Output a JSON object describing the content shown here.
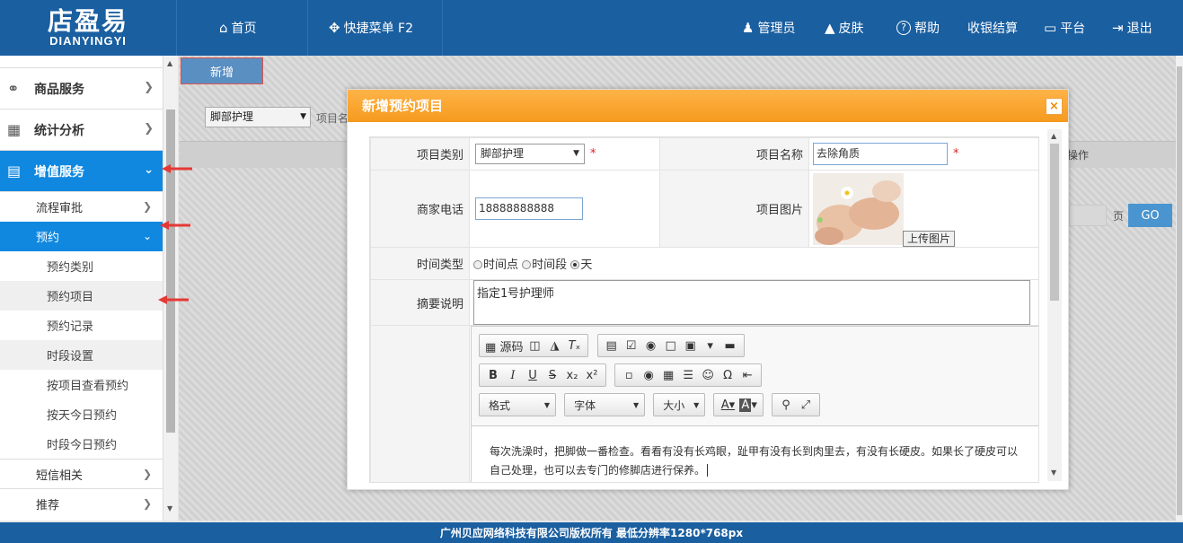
{
  "header": {
    "logo_main": "店盈易",
    "logo_sub": "DIANYINGYI",
    "nav_left": [
      {
        "icon": "home-icon",
        "glyph": "⌂",
        "label": "首页"
      },
      {
        "icon": "move-icon",
        "glyph": "✥",
        "label": "快捷菜单 F2"
      }
    ],
    "nav_right": [
      {
        "icon": "user-icon",
        "glyph": "👤",
        "label": "管理员"
      },
      {
        "icon": "shirt-icon",
        "glyph": "👕",
        "label": "皮肤"
      },
      {
        "icon": "help-icon",
        "glyph": "?",
        "label": "帮助"
      },
      {
        "icon": "",
        "glyph": "",
        "label": "收银结算"
      },
      {
        "icon": "monitor-icon",
        "glyph": "▭",
        "label": "平台"
      },
      {
        "icon": "logout-icon",
        "glyph": "⇥",
        "label": "退出"
      }
    ]
  },
  "sidebar": {
    "mains": [
      {
        "label": "商品服务",
        "icon": "link-icon",
        "glyph": "🔗"
      },
      {
        "label": "统计分析",
        "icon": "chart-icon",
        "glyph": "📊"
      },
      {
        "label": "增值服务",
        "icon": "map-icon",
        "glyph": "🗺"
      }
    ],
    "subs": {
      "flow": "流程审批",
      "booking": "预约",
      "sms": "短信相关",
      "recommend": "推荐"
    },
    "leaves": [
      "预约类别",
      "预约项目",
      "预约记录",
      "时段设置",
      "按项目查看预约",
      "按天今日预约",
      "时段今日预约"
    ]
  },
  "main": {
    "add_button": "新增",
    "filter_select": "脚部护理",
    "filter_label": "项目名",
    "col_operation": "操作",
    "page_label": "页",
    "go_button": "GO"
  },
  "dialog": {
    "title": "新增预约项目",
    "close": "×",
    "fields": {
      "category_label": "项目类别",
      "category_value": "脚部护理",
      "name_label": "项目名称",
      "name_value": "去除角质",
      "phone_label": "商家电话",
      "phone_value": "18888888888",
      "image_label": "项目图片",
      "upload_button": "上传图片",
      "time_type_label": "时间类型",
      "time_options": [
        "时间点",
        "时间段",
        "天"
      ],
      "time_selected": 2,
      "summary_label": "摘要说明",
      "summary_value": "指定1号护理师",
      "required_mark": "*"
    },
    "editor": {
      "source_label": "源码",
      "combo_format": "格式",
      "combo_font": "字体",
      "combo_size": "大小",
      "content": "每次洗澡时，把脚做一番检查。看看有没有长鸡眼，趾甲有没有长到肉里去，有没有长硬皮。如果长了硬皮可以自己处理，也可以去专门的修脚店进行保养。"
    }
  },
  "footer": {
    "text": "广州贝应网络科技有限公司版权所有 最低分辨率1280*768px"
  },
  "colors": {
    "header": "#1a5fa0",
    "active": "#1088e0",
    "dialog_title": "#f59a1e",
    "arrow": "#e53935"
  }
}
